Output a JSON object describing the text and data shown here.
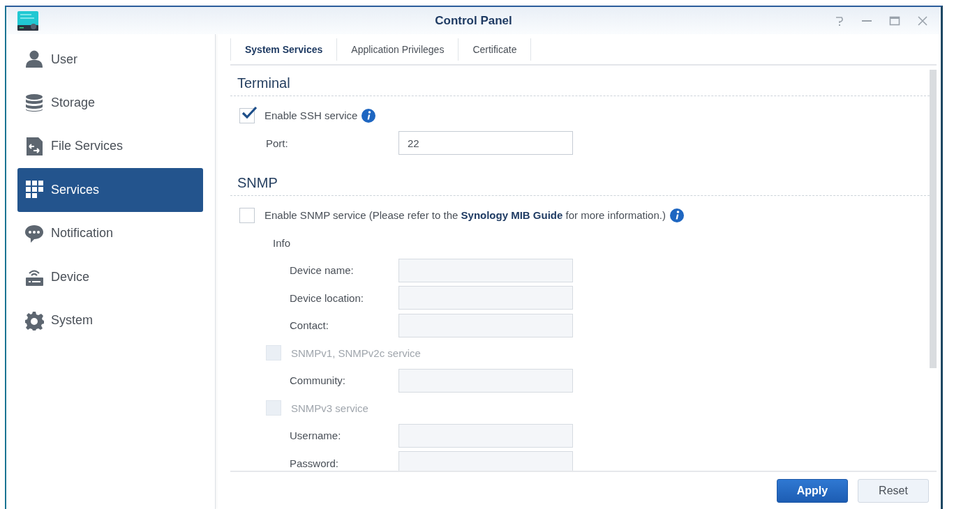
{
  "window": {
    "title": "Control Panel"
  },
  "sidebar": {
    "items": [
      {
        "label": "User",
        "selected": false
      },
      {
        "label": "Storage",
        "selected": false
      },
      {
        "label": "File Services",
        "selected": false
      },
      {
        "label": "Services",
        "selected": true
      },
      {
        "label": "Notification",
        "selected": false
      },
      {
        "label": "Device",
        "selected": false
      },
      {
        "label": "System",
        "selected": false
      }
    ]
  },
  "tabs": [
    {
      "label": "System Services",
      "selected": true
    },
    {
      "label": "Application Privileges",
      "selected": false
    },
    {
      "label": "Certificate",
      "selected": false
    }
  ],
  "sections": [
    {
      "title": "Terminal",
      "rows": [
        {
          "kind": "checkbox",
          "label": "Enable SSH service",
          "checked": true,
          "disabled": false,
          "info": true,
          "children": [
            {
              "kind": "field",
              "label": "Port:",
              "value": "22",
              "disabled": false
            }
          ]
        }
      ]
    },
    {
      "title": "SNMP",
      "rows": [
        {
          "kind": "checkbox",
          "label": "Enable SNMP service (Please refer to the",
          "link": "Synology MIB Guide",
          "label_after": "for more information.)",
          "checked": false,
          "disabled": false,
          "info": true,
          "children": [
            {
              "kind": "group",
              "label": "Info",
              "children": [
                {
                  "kind": "field",
                  "label": "Device name:",
                  "disabled": true
                },
                {
                  "kind": "field",
                  "label": "Device location:",
                  "disabled": true
                },
                {
                  "kind": "field",
                  "label": "Contact:",
                  "disabled": true
                }
              ]
            },
            {
              "kind": "checkbox",
              "label": "SNMPv1, SNMPv2c service",
              "checked": false,
              "disabled": true,
              "children": [
                {
                  "kind": "field",
                  "label": "Community:",
                  "disabled": true
                }
              ]
            },
            {
              "kind": "checkbox",
              "label": "SNMPv3 service",
              "checked": false,
              "disabled": true,
              "children": [
                {
                  "kind": "field",
                  "label": "Username:",
                  "disabled": true
                },
                {
                  "kind": "field",
                  "label": "Password:",
                  "disabled": true
                }
              ]
            }
          ]
        }
      ]
    }
  ],
  "buttons": [
    {
      "label": "Apply",
      "kind": "primary"
    },
    {
      "label": "Reset",
      "kind": "secondary"
    }
  ]
}
